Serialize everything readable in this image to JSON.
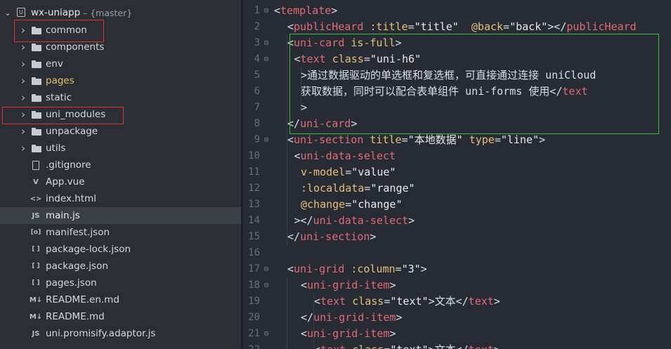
{
  "project": {
    "name": "wx-uniapp",
    "branch": "– {master}"
  },
  "tree": [
    {
      "label": "common",
      "kind": "folder",
      "highlight": true,
      "labelColor": "#d6d9de"
    },
    {
      "label": "components",
      "kind": "folder",
      "labelColor": "#d6d9de"
    },
    {
      "label": "env",
      "kind": "folder",
      "labelColor": "#d6d9de"
    },
    {
      "label": "pages",
      "kind": "folder",
      "labelColor": "#e2c56a"
    },
    {
      "label": "static",
      "kind": "folder",
      "labelColor": "#d6d9de"
    },
    {
      "label": "uni_modules",
      "kind": "folder",
      "highlight": true,
      "labelColor": "#d6d9de"
    },
    {
      "label": "unpackage",
      "kind": "folder",
      "labelColor": "#d6d9de"
    },
    {
      "label": "utils",
      "kind": "folder",
      "labelColor": "#d6d9de"
    },
    {
      "label": ".gitignore",
      "kind": "file",
      "icon": "file-icon",
      "labelColor": "#d6d9de"
    },
    {
      "label": "App.vue",
      "kind": "file",
      "icon": "vue-file-icon",
      "glyph": "V",
      "labelColor": "#d6d9de"
    },
    {
      "label": "index.html",
      "kind": "file",
      "icon": "html-file-icon",
      "glyph": "<>",
      "labelColor": "#d6d9de"
    },
    {
      "label": "main.js",
      "kind": "file",
      "icon": "js-file-icon",
      "glyph": "JS",
      "selected": true,
      "labelColor": "#e8eaed"
    },
    {
      "label": "manifest.json",
      "kind": "file",
      "icon": "manifest-file-icon",
      "glyph": "[o]",
      "labelColor": "#d6d9de"
    },
    {
      "label": "package-lock.json",
      "kind": "file",
      "icon": "json-file-icon",
      "glyph": "[ ]",
      "labelColor": "#d6d9de"
    },
    {
      "label": "package.json",
      "kind": "file",
      "icon": "json-file-icon",
      "glyph": "[ ]",
      "labelColor": "#d6d9de"
    },
    {
      "label": "pages.json",
      "kind": "file",
      "icon": "json-file-icon",
      "glyph": "[ ]",
      "labelColor": "#d6d9de"
    },
    {
      "label": "README.en.md",
      "kind": "file",
      "icon": "markdown-file-icon",
      "glyph": "M↓",
      "labelColor": "#d6d9de"
    },
    {
      "label": "README.md",
      "kind": "file",
      "icon": "markdown-file-icon",
      "glyph": "M↓",
      "labelColor": "#d6d9de"
    },
    {
      "label": "uni.promisify.adaptor.js",
      "kind": "file",
      "icon": "js-file-icon",
      "glyph": "JS",
      "labelColor": "#d6d9de"
    }
  ],
  "colors": {
    "tag": "#e06c75",
    "attr": "#e5c07b",
    "string": "#eaeaea",
    "text": "#dcdfe4",
    "highlight_red": "#e0322f",
    "highlight_green": "#3bbf3b"
  },
  "code_lines": [
    {
      "n": "1",
      "fold": "⊟",
      "tokens": [
        [
          "punc",
          "<"
        ],
        [
          "tag",
          "template"
        ],
        [
          "punc",
          ">"
        ]
      ]
    },
    {
      "n": "2",
      "indent": 2,
      "tokens": [
        [
          "punc",
          "<"
        ],
        [
          "tag",
          "publicHeard"
        ],
        [
          "txt",
          " "
        ],
        [
          "attr",
          ":title"
        ],
        [
          "punc",
          "="
        ],
        [
          "str",
          "\"title\""
        ],
        [
          "txt",
          "  "
        ],
        [
          "attr",
          "@back"
        ],
        [
          "punc",
          "="
        ],
        [
          "str",
          "\"back\""
        ],
        [
          "punc",
          "></"
        ],
        [
          "tag",
          "publicHeard"
        ]
      ]
    },
    {
      "n": "3",
      "fold": "⊟",
      "indent": 2,
      "tokens": [
        [
          "punc",
          "<"
        ],
        [
          "tag",
          "uni-card"
        ],
        [
          "txt",
          " "
        ],
        [
          "attr",
          "is-full"
        ],
        [
          "punc",
          ">"
        ]
      ]
    },
    {
      "n": "4",
      "fold": "⊟",
      "indent": 3,
      "tokens": [
        [
          "punc",
          "<"
        ],
        [
          "tag",
          "text"
        ],
        [
          "txt",
          " "
        ],
        [
          "attr",
          "class"
        ],
        [
          "punc",
          "="
        ],
        [
          "str",
          "\"uni-h6\""
        ]
      ]
    },
    {
      "n": "5",
      "indent": 4,
      "tokens": [
        [
          "txt",
          ">通过数据驱动的单选框和复选框，可直接通过连接 uniCloud"
        ]
      ]
    },
    {
      "n": "6",
      "indent": 4,
      "tokens": [
        [
          "txt",
          "获取数据，同时可以配合表单组件 uni-forms 使用</"
        ],
        [
          "tag",
          "text"
        ]
      ]
    },
    {
      "n": "7",
      "indent": 4,
      "tokens": [
        [
          "punc",
          ">"
        ]
      ]
    },
    {
      "n": "8",
      "indent": 2,
      "tokens": [
        [
          "punc",
          "</"
        ],
        [
          "tag",
          "uni-card"
        ],
        [
          "punc",
          ">"
        ]
      ]
    },
    {
      "n": "9",
      "fold": "⊟",
      "indent": 2,
      "tokens": [
        [
          "punc",
          "<"
        ],
        [
          "tag",
          "uni-section"
        ],
        [
          "txt",
          " "
        ],
        [
          "attr",
          "title"
        ],
        [
          "punc",
          "="
        ],
        [
          "str",
          "\"本地数据\""
        ],
        [
          "txt",
          " "
        ],
        [
          "attr",
          "type"
        ],
        [
          "punc",
          "="
        ],
        [
          "str",
          "\"line\""
        ],
        [
          "punc",
          ">"
        ]
      ]
    },
    {
      "n": "10",
      "indent": 3,
      "tokens": [
        [
          "punc",
          "<"
        ],
        [
          "tag",
          "uni-data-select"
        ]
      ]
    },
    {
      "n": "11",
      "indent": 4,
      "tokens": [
        [
          "attr",
          "v-model"
        ],
        [
          "punc",
          "="
        ],
        [
          "str",
          "\"value\""
        ]
      ]
    },
    {
      "n": "12",
      "indent": 4,
      "tokens": [
        [
          "attr",
          ":localdata"
        ],
        [
          "punc",
          "="
        ],
        [
          "str",
          "\"range\""
        ]
      ]
    },
    {
      "n": "13",
      "indent": 4,
      "tokens": [
        [
          "attr",
          "@change"
        ],
        [
          "punc",
          "="
        ],
        [
          "str",
          "\"change\""
        ]
      ]
    },
    {
      "n": "14",
      "indent": 3,
      "tokens": [
        [
          "punc",
          "></"
        ],
        [
          "tag",
          "uni-data-select"
        ],
        [
          "punc",
          ">"
        ]
      ]
    },
    {
      "n": "15",
      "indent": 2,
      "tokens": [
        [
          "punc",
          "</"
        ],
        [
          "tag",
          "uni-section"
        ],
        [
          "punc",
          ">"
        ]
      ]
    },
    {
      "n": "16",
      "tokens": []
    },
    {
      "n": "17",
      "fold": "⊟",
      "indent": 2,
      "tokens": [
        [
          "punc",
          "<"
        ],
        [
          "tag",
          "uni-grid"
        ],
        [
          "txt",
          " "
        ],
        [
          "attr",
          ":column"
        ],
        [
          "punc",
          "="
        ],
        [
          "str",
          "\"3\""
        ],
        [
          "punc",
          ">"
        ]
      ]
    },
    {
      "n": "18",
      "fold": "⊟",
      "indent": 4,
      "tokens": [
        [
          "punc",
          "<"
        ],
        [
          "tag",
          "uni-grid-item"
        ],
        [
          "punc",
          ">"
        ]
      ]
    },
    {
      "n": "19",
      "indent": 6,
      "tokens": [
        [
          "punc",
          "<"
        ],
        [
          "tag",
          "text"
        ],
        [
          "txt",
          " "
        ],
        [
          "attr",
          "class"
        ],
        [
          "punc",
          "="
        ],
        [
          "str",
          "\"text\""
        ],
        [
          "punc",
          ">"
        ],
        [
          "txt",
          "文本"
        ],
        [
          "punc",
          "</"
        ],
        [
          "tag",
          "text"
        ],
        [
          "punc",
          ">"
        ]
      ]
    },
    {
      "n": "20",
      "indent": 4,
      "tokens": [
        [
          "punc",
          "</"
        ],
        [
          "tag",
          "uni-grid-item"
        ],
        [
          "punc",
          ">"
        ]
      ]
    },
    {
      "n": "21",
      "fold": "⊟",
      "indent": 4,
      "tokens": [
        [
          "punc",
          "<"
        ],
        [
          "tag",
          "uni-grid-item"
        ],
        [
          "punc",
          ">"
        ]
      ]
    },
    {
      "n": "22",
      "indent": 6,
      "tokens": [
        [
          "punc",
          "<"
        ],
        [
          "tag",
          "text"
        ],
        [
          "txt",
          " "
        ],
        [
          "attr",
          "class"
        ],
        [
          "punc",
          "="
        ],
        [
          "str",
          "\"text\""
        ],
        [
          "punc",
          ">"
        ],
        [
          "txt",
          "文本"
        ],
        [
          "punc",
          "</"
        ],
        [
          "tag",
          "text"
        ],
        [
          "punc",
          ">"
        ]
      ]
    }
  ]
}
